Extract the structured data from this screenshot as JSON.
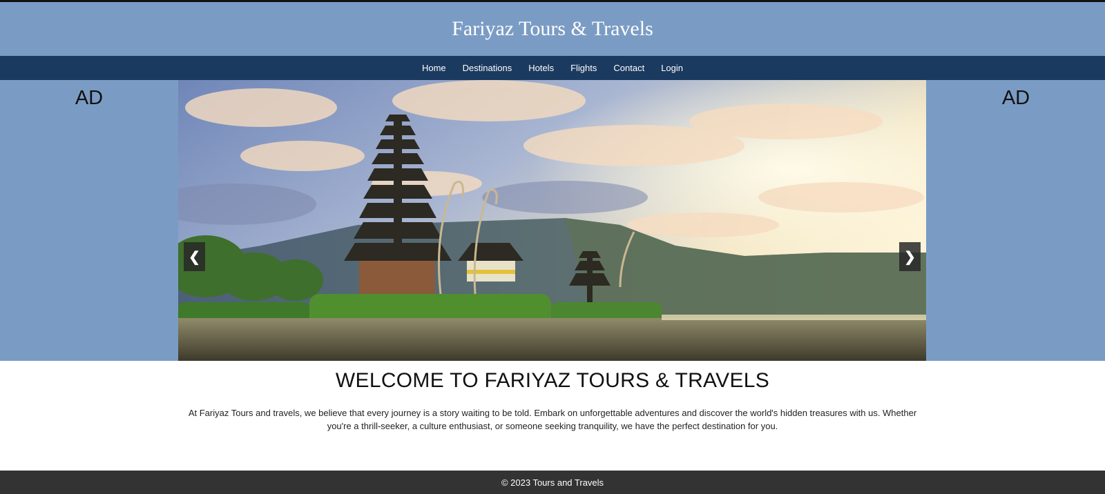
{
  "header": {
    "title": "Fariyaz Tours & Travels"
  },
  "nav": {
    "items": [
      {
        "label": "Home"
      },
      {
        "label": "Destinations"
      },
      {
        "label": "Hotels"
      },
      {
        "label": "Flights"
      },
      {
        "label": "Contact"
      },
      {
        "label": "Login"
      }
    ]
  },
  "ads": {
    "left": "AD",
    "right": "AD"
  },
  "slider": {
    "prev_label": "❮",
    "next_label": "❯"
  },
  "welcome": {
    "heading": "WELCOME TO FARIYAZ TOURS & TRAVELS",
    "text": "At Fariyaz Tours and travels, we believe that every journey is a story waiting to be told. Embark on unforgettable adventures and discover the world's hidden treasures with us. Whether you're a thrill-seeker, a culture enthusiast, or someone seeking tranquility, we have the perfect destination for you."
  },
  "footer": {
    "text": "© 2023 Tours and Travels"
  },
  "colors": {
    "header_bg": "#7a9cc4",
    "nav_bg": "#1b3a5f",
    "footer_bg": "#333333"
  }
}
